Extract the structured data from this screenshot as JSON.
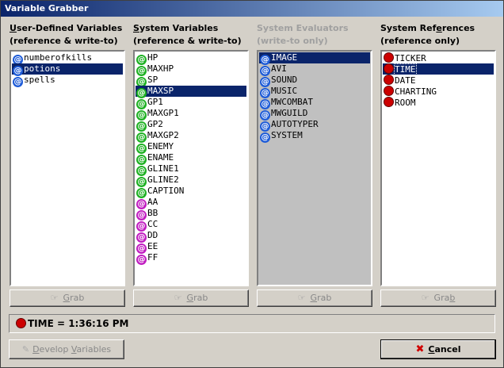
{
  "window": {
    "title": "Variable Grabber"
  },
  "columns": [
    {
      "title_pre": "",
      "title_u": "U",
      "title_post": "ser-Defined Variables",
      "subtitle": "(reference & write-to)",
      "icon": "blue",
      "disabled": false,
      "items": [
        {
          "label": "numberofkills",
          "selected": false
        },
        {
          "label": "potions",
          "selected": true
        },
        {
          "label": "spells",
          "selected": false
        }
      ],
      "grab_pre": "",
      "grab_u": "G",
      "grab_post": "rab"
    },
    {
      "title_pre": "",
      "title_u": "S",
      "title_post": "ystem Variables",
      "subtitle": "(reference & write-to)",
      "icon": "green",
      "disabled": false,
      "items": [
        {
          "label": "HP",
          "selected": false,
          "icon": "green"
        },
        {
          "label": "MAXHP",
          "selected": false,
          "icon": "green"
        },
        {
          "label": "SP",
          "selected": false,
          "icon": "green"
        },
        {
          "label": "MAXSP",
          "selected": true,
          "icon": "green"
        },
        {
          "label": "GP1",
          "selected": false,
          "icon": "green"
        },
        {
          "label": "MAXGP1",
          "selected": false,
          "icon": "green"
        },
        {
          "label": "GP2",
          "selected": false,
          "icon": "green"
        },
        {
          "label": "MAXGP2",
          "selected": false,
          "icon": "green"
        },
        {
          "label": "ENEMY",
          "selected": false,
          "icon": "green"
        },
        {
          "label": "ENAME",
          "selected": false,
          "icon": "green"
        },
        {
          "label": "GLINE1",
          "selected": false,
          "icon": "green"
        },
        {
          "label": "GLINE2",
          "selected": false,
          "icon": "green"
        },
        {
          "label": "CAPTION",
          "selected": false,
          "icon": "green"
        },
        {
          "label": "AA",
          "selected": false,
          "icon": "magenta"
        },
        {
          "label": "BB",
          "selected": false,
          "icon": "magenta"
        },
        {
          "label": "CC",
          "selected": false,
          "icon": "magenta"
        },
        {
          "label": "DD",
          "selected": false,
          "icon": "magenta"
        },
        {
          "label": "EE",
          "selected": false,
          "icon": "magenta"
        },
        {
          "label": "FF",
          "selected": false,
          "icon": "magenta"
        }
      ],
      "grab_pre": "",
      "grab_u": "G",
      "grab_post": "rab"
    },
    {
      "title_pre": "",
      "title_u": "",
      "title_post": "System Evaluators",
      "subtitle": "(write-to only)",
      "icon": "blue",
      "disabled": true,
      "items": [
        {
          "label": "IMAGE",
          "selected": true
        },
        {
          "label": "AVI",
          "selected": false
        },
        {
          "label": "SOUND",
          "selected": false
        },
        {
          "label": "MUSIC",
          "selected": false
        },
        {
          "label": "MWCOMBAT",
          "selected": false
        },
        {
          "label": "MWGUILD",
          "selected": false
        },
        {
          "label": "AUTOTYPER",
          "selected": false
        },
        {
          "label": "SYSTEM",
          "selected": false
        }
      ],
      "grab_pre": "",
      "grab_u": "G",
      "grab_post": "rab"
    },
    {
      "title_pre": "System Ref",
      "title_u": "e",
      "title_post": "rences",
      "subtitle": "(reference only)",
      "icon": "red",
      "disabled": false,
      "items": [
        {
          "label": "TICKER",
          "selected": false
        },
        {
          "label": "TIME",
          "selected": true
        },
        {
          "label": "DATE",
          "selected": false
        },
        {
          "label": "CHARTING",
          "selected": false
        },
        {
          "label": "ROOM",
          "selected": false
        }
      ],
      "grab_pre": "Gra",
      "grab_u": "b",
      "grab_post": ""
    }
  ],
  "status": {
    "text": "TIME = 1:36:16 PM"
  },
  "buttons": {
    "develop_pre": "",
    "develop_u": "D",
    "develop_mid": "evelop ",
    "develop_u2": "V",
    "develop_post": "ariables",
    "cancel_u": "C",
    "cancel_post": "ancel"
  },
  "colors": {
    "title_bar": "#0a246a",
    "selection": "#0a246a",
    "face": "#d4d0c8"
  }
}
